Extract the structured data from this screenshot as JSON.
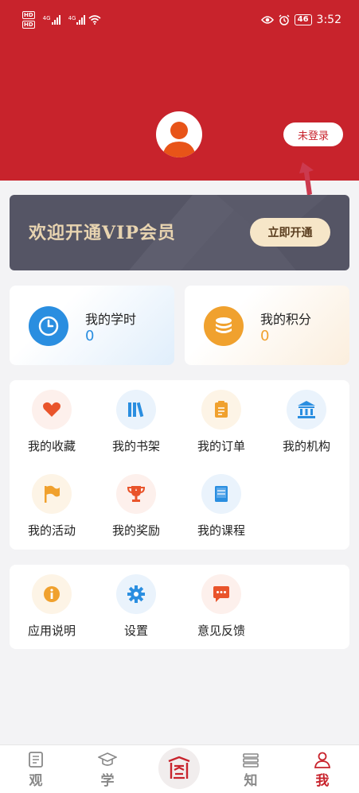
{
  "status_bar": {
    "hd1": "HD",
    "hd2": "HD",
    "net1": "4G",
    "net2": "4G",
    "battery": "46",
    "time": "3:52"
  },
  "profile": {
    "login_label": "未登录"
  },
  "vip_banner": {
    "title": "欢迎开通VIP会员",
    "button_label": "立即开通"
  },
  "stats": [
    {
      "label": "我的学时",
      "value": "0",
      "color": "#2a8ee0"
    },
    {
      "label": "我的积分",
      "value": "0",
      "color": "#f0a12e"
    }
  ],
  "menu_items": [
    {
      "label": "我的收藏",
      "icon": "heart-icon",
      "color": "#e9542b",
      "bg": "#fdf0ec"
    },
    {
      "label": "我的书架",
      "icon": "bookshelf-icon",
      "color": "#2a8ee0",
      "bg": "#eaf3fc"
    },
    {
      "label": "我的订单",
      "icon": "clipboard-icon",
      "color": "#f0a12e",
      "bg": "#fdf4e6"
    },
    {
      "label": "我的机构",
      "icon": "institution-icon",
      "color": "#2a8ee0",
      "bg": "#eaf3fc"
    },
    {
      "label": "我的活动",
      "icon": "flag-icon",
      "color": "#f0a12e",
      "bg": "#fdf4e6"
    },
    {
      "label": "我的奖励",
      "icon": "trophy-icon",
      "color": "#e9542b",
      "bg": "#fdf0ec"
    },
    {
      "label": "我的课程",
      "icon": "book-icon",
      "color": "#2a8ee0",
      "bg": "#eaf3fc"
    }
  ],
  "other_items": [
    {
      "label": "应用说明",
      "icon": "info-icon",
      "color": "#f0a12e",
      "bg": "#fdf4e6"
    },
    {
      "label": "设置",
      "icon": "gear-icon",
      "color": "#2a8ee0",
      "bg": "#eaf3fc"
    },
    {
      "label": "意见反馈",
      "icon": "chat-icon",
      "color": "#e9542b",
      "bg": "#fdf0ec"
    }
  ],
  "tabs": [
    {
      "label": "观",
      "icon": "document-icon"
    },
    {
      "label": "学",
      "icon": "graduation-cap-icon"
    },
    {
      "label": "",
      "icon": "seal-logo-icon"
    },
    {
      "label": "知",
      "icon": "books-icon"
    },
    {
      "label": "我",
      "icon": "person-icon",
      "active": true
    }
  ],
  "colors": {
    "header_red": "#c8232c",
    "vip_bg": "#555565",
    "vip_gold": "#e8d4b0",
    "tab_active": "#c8232c",
    "tab_inactive": "#888888"
  }
}
